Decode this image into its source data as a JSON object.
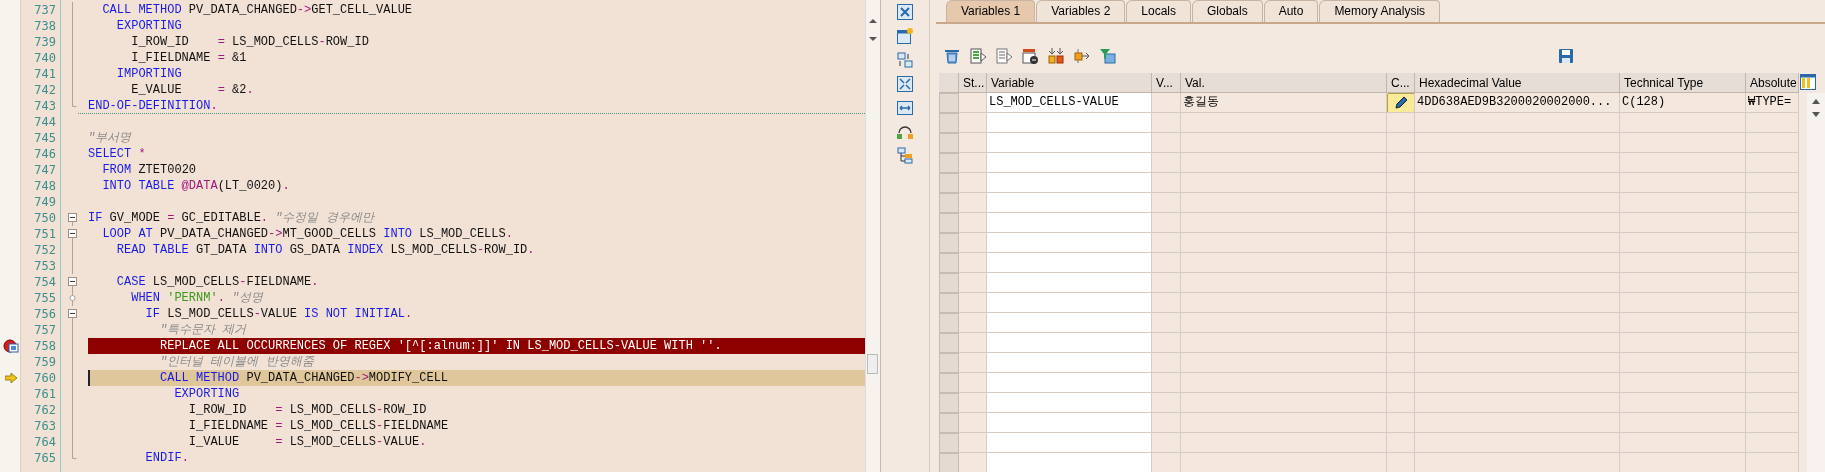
{
  "editor": {
    "lines": [
      {
        "number": "737",
        "breakpoint": false,
        "current": false,
        "kind": "line",
        "segments": [
          {
            "text": "  CALL METHOD",
            "kind": "keyword"
          },
          {
            "text": " PV_DATA_CHANGED",
            "kind": "plain"
          },
          {
            "text": "->",
            "kind": "operator"
          },
          {
            "text": "GET_CELL_VALUE",
            "kind": "plain"
          }
        ]
      },
      {
        "number": "738",
        "breakpoint": false,
        "current": false,
        "kind": "line",
        "segments": [
          {
            "text": "    EXPORTING",
            "kind": "keyword"
          }
        ]
      },
      {
        "number": "739",
        "breakpoint": false,
        "current": false,
        "kind": "line",
        "segments": [
          {
            "text": "      I_ROW_ID    ",
            "kind": "plain"
          },
          {
            "text": "=",
            "kind": "operator"
          },
          {
            "text": " LS_MOD_CELLS",
            "kind": "plain"
          },
          {
            "text": "-",
            "kind": "operator"
          },
          {
            "text": "ROW_ID",
            "kind": "plain"
          }
        ]
      },
      {
        "number": "740",
        "breakpoint": false,
        "current": false,
        "kind": "line",
        "segments": [
          {
            "text": "      I_FIELDNAME ",
            "kind": "plain"
          },
          {
            "text": "=",
            "kind": "operator"
          },
          {
            "text": " &1",
            "kind": "plain"
          }
        ]
      },
      {
        "number": "741",
        "breakpoint": false,
        "current": false,
        "kind": "line",
        "segments": [
          {
            "text": "    IMPORTING",
            "kind": "keyword"
          }
        ]
      },
      {
        "number": "742",
        "breakpoint": false,
        "current": false,
        "kind": "line",
        "segments": [
          {
            "text": "      E_VALUE     ",
            "kind": "plain"
          },
          {
            "text": "=",
            "kind": "operator"
          },
          {
            "text": " &2",
            "kind": "plain"
          },
          {
            "text": ".",
            "kind": "operator"
          }
        ]
      },
      {
        "number": "743",
        "breakpoint": false,
        "current": false,
        "kind": "end",
        "separator_below": true,
        "segments": [
          {
            "text": "END-OF-DEFINITION",
            "kind": "keyword"
          },
          {
            "text": ".",
            "kind": "operator"
          }
        ]
      },
      {
        "number": "744",
        "breakpoint": false,
        "current": false,
        "kind": "blank"
      },
      {
        "number": "745",
        "breakpoint": false,
        "current": false,
        "kind": "blank",
        "segments": [
          {
            "text": "\"부서명",
            "kind": "comment"
          }
        ]
      },
      {
        "number": "746",
        "breakpoint": false,
        "current": false,
        "kind": "blank",
        "segments": [
          {
            "text": "SELECT",
            "kind": "keyword"
          },
          {
            "text": " *",
            "kind": "operator"
          }
        ]
      },
      {
        "number": "747",
        "breakpoint": false,
        "current": false,
        "kind": "blank",
        "segments": [
          {
            "text": "  FROM",
            "kind": "keyword"
          },
          {
            "text": " ZTET0020",
            "kind": "plain"
          }
        ]
      },
      {
        "number": "748",
        "breakpoint": false,
        "current": false,
        "kind": "blank",
        "segments": [
          {
            "text": "  INTO TABLE",
            "kind": "keyword"
          },
          {
            "text": " @DATA",
            "kind": "operator"
          },
          {
            "text": "(LT_0020)",
            "kind": "plain"
          },
          {
            "text": ".",
            "kind": "operator"
          }
        ]
      },
      {
        "number": "749",
        "breakpoint": false,
        "current": false,
        "kind": "blank"
      },
      {
        "number": "750",
        "breakpoint": false,
        "current": false,
        "kind": "open",
        "segments": [
          {
            "text": "IF",
            "kind": "keyword"
          },
          {
            "text": " GV_MODE ",
            "kind": "plain"
          },
          {
            "text": "=",
            "kind": "operator"
          },
          {
            "text": " GC_EDITABLE",
            "kind": "plain"
          },
          {
            "text": ".",
            "kind": "operator"
          },
          {
            "text": " \"수정일 경우에만",
            "kind": "comment"
          }
        ]
      },
      {
        "number": "751",
        "breakpoint": false,
        "current": false,
        "kind": "open",
        "segments": [
          {
            "text": "  LOOP AT",
            "kind": "keyword"
          },
          {
            "text": " PV_DATA_CHANGED",
            "kind": "plain"
          },
          {
            "text": "->",
            "kind": "operator"
          },
          {
            "text": "MT_GOOD_CELLS ",
            "kind": "plain"
          },
          {
            "text": "INTO",
            "kind": "keyword"
          },
          {
            "text": " LS_MOD_CELLS",
            "kind": "plain"
          },
          {
            "text": ".",
            "kind": "operator"
          }
        ]
      },
      {
        "number": "752",
        "breakpoint": false,
        "current": false,
        "kind": "line",
        "segments": [
          {
            "text": "    READ TABLE",
            "kind": "keyword"
          },
          {
            "text": " GT_DATA ",
            "kind": "plain"
          },
          {
            "text": "INTO",
            "kind": "keyword"
          },
          {
            "text": " GS_DATA ",
            "kind": "plain"
          },
          {
            "text": "INDEX",
            "kind": "keyword"
          },
          {
            "text": " LS_MOD_CELLS",
            "kind": "plain"
          },
          {
            "text": "-",
            "kind": "operator"
          },
          {
            "text": "ROW_ID",
            "kind": "plain"
          },
          {
            "text": ".",
            "kind": "operator"
          }
        ]
      },
      {
        "number": "753",
        "breakpoint": false,
        "current": false,
        "kind": "line"
      },
      {
        "number": "754",
        "breakpoint": false,
        "current": false,
        "kind": "open",
        "segments": [
          {
            "text": "    CASE",
            "kind": "keyword"
          },
          {
            "text": " LS_MOD_CELLS",
            "kind": "plain"
          },
          {
            "text": "-",
            "kind": "operator"
          },
          {
            "text": "FIELDNAME",
            "kind": "plain"
          },
          {
            "text": ".",
            "kind": "operator"
          }
        ]
      },
      {
        "number": "755",
        "breakpoint": false,
        "current": false,
        "kind": "node",
        "segments": [
          {
            "text": "      WHEN",
            "kind": "keyword"
          },
          {
            "text": " 'PERNM'",
            "kind": "string"
          },
          {
            "text": ".",
            "kind": "operator"
          },
          {
            "text": " \"성명",
            "kind": "comment"
          }
        ]
      },
      {
        "number": "756",
        "breakpoint": false,
        "current": false,
        "kind": "open",
        "segments": [
          {
            "text": "        IF",
            "kind": "keyword"
          },
          {
            "text": " LS_MOD_CELLS",
            "kind": "plain"
          },
          {
            "text": "-",
            "kind": "operator"
          },
          {
            "text": "VALUE ",
            "kind": "plain"
          },
          {
            "text": "IS NOT INITIAL",
            "kind": "keyword"
          },
          {
            "text": ".",
            "kind": "operator"
          }
        ]
      },
      {
        "number": "757",
        "breakpoint": false,
        "current": false,
        "kind": "line",
        "segments": [
          {
            "text": "          \"특수문자 제거",
            "kind": "comment"
          }
        ]
      },
      {
        "number": "758",
        "kind": "line",
        "breakpoint": true,
        "current": false,
        "segments": [
          {
            "text": "          REPLACE ALL OCCURRENCES OF REGEX '[^[:alnum:]]' IN LS_MOD_CELLS-VALUE WITH ''.",
            "kind": "plain"
          }
        ]
      },
      {
        "number": "759",
        "breakpoint": false,
        "current": false,
        "kind": "line",
        "segments": [
          {
            "text": "          \"인터널 테이블에 반영해줌",
            "kind": "comment"
          }
        ]
      },
      {
        "number": "760",
        "kind": "line",
        "breakpoint": false,
        "current": true,
        "segments": [
          {
            "text": "          CALL METHOD",
            "kind": "keyword"
          },
          {
            "text": " PV_DATA_CHANGED",
            "kind": "plain"
          },
          {
            "text": "->",
            "kind": "operator"
          },
          {
            "text": "MODIFY_CELL",
            "kind": "plain"
          }
        ]
      },
      {
        "number": "761",
        "breakpoint": false,
        "current": false,
        "kind": "line",
        "segments": [
          {
            "text": "            EXPORTING",
            "kind": "keyword"
          }
        ]
      },
      {
        "number": "762",
        "breakpoint": false,
        "current": false,
        "kind": "line",
        "segments": [
          {
            "text": "              I_ROW_ID    ",
            "kind": "plain"
          },
          {
            "text": "=",
            "kind": "operator"
          },
          {
            "text": " LS_MOD_CELLS",
            "kind": "plain"
          },
          {
            "text": "-",
            "kind": "operator"
          },
          {
            "text": "ROW_ID",
            "kind": "plain"
          }
        ]
      },
      {
        "number": "763",
        "breakpoint": false,
        "current": false,
        "kind": "line",
        "segments": [
          {
            "text": "              I_FIELDNAME ",
            "kind": "plain"
          },
          {
            "text": "=",
            "kind": "operator"
          },
          {
            "text": " LS_MOD_CELLS",
            "kind": "plain"
          },
          {
            "text": "-",
            "kind": "operator"
          },
          {
            "text": "FIELDNAME",
            "kind": "plain"
          }
        ]
      },
      {
        "number": "764",
        "breakpoint": false,
        "current": false,
        "kind": "line",
        "segments": [
          {
            "text": "              I_VALUE     ",
            "kind": "plain"
          },
          {
            "text": "=",
            "kind": "operator"
          },
          {
            "text": " LS_MOD_CELLS",
            "kind": "plain"
          },
          {
            "text": "-",
            "kind": "operator"
          },
          {
            "text": "VALUE",
            "kind": "plain"
          },
          {
            "text": ".",
            "kind": "operator"
          }
        ]
      },
      {
        "number": "765",
        "breakpoint": false,
        "current": false,
        "kind": "end",
        "segments": [
          {
            "text": "        ENDIF",
            "kind": "keyword"
          },
          {
            "text": ".",
            "kind": "operator"
          }
        ]
      }
    ]
  },
  "tabs": [
    {
      "label": "Variables 1",
      "selected": true
    },
    {
      "label": "Variables 2",
      "selected": false
    },
    {
      "label": "Locals",
      "selected": false
    },
    {
      "label": "Globals",
      "selected": false
    },
    {
      "label": "Auto",
      "selected": false
    },
    {
      "label": "Memory Analysis",
      "selected": false
    }
  ],
  "table": {
    "columns": [
      "St...",
      "Variable",
      "V...",
      "Val.",
      "C...",
      "Hexadecimal Value",
      "Technical Type",
      "Absolute"
    ],
    "rows": [
      {
        "variable": "LS_MOD_CELLS-VALUE",
        "value": "홍길동",
        "hex_value": "4DD638AED9B3200020002000...",
        "technical_type": "C(128)",
        "absolute": "₩TYPE="
      }
    ]
  }
}
